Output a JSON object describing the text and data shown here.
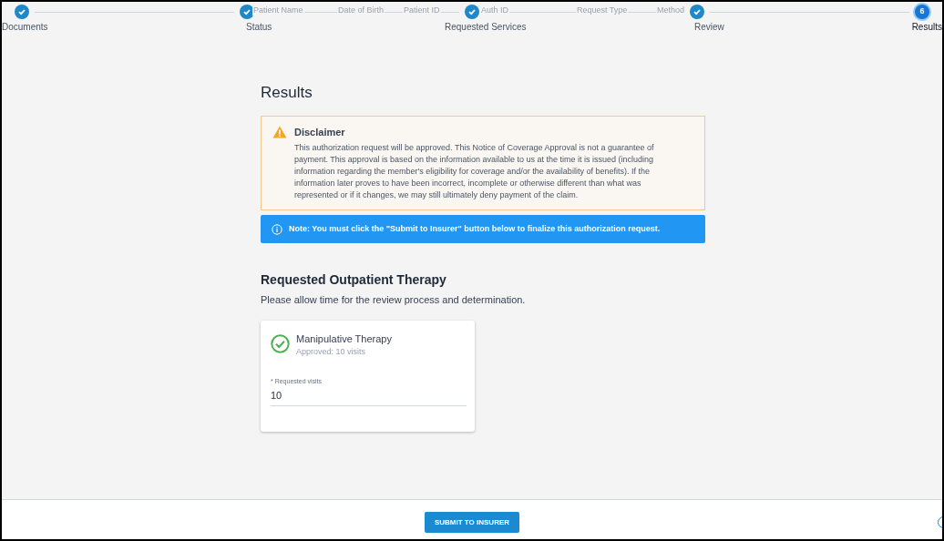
{
  "stepper": {
    "steps": [
      {
        "label": "Documents",
        "done": true,
        "selected": false
      },
      {
        "label": "Status",
        "done": true,
        "selected": false
      },
      {
        "label": "Requested Services",
        "done": true,
        "selected": false
      },
      {
        "label": "Review",
        "done": true,
        "selected": false
      },
      {
        "label": "Results",
        "done": false,
        "selected": true,
        "number": "6"
      }
    ]
  },
  "faded_header": [
    "Patient Name",
    "Date of Birth",
    "Patient ID",
    "Auth ID",
    "Request Type",
    "Method"
  ],
  "title": "Results",
  "disclaimer": {
    "title": "Disclaimer",
    "text": "This authorization request will be approved. This Notice of Coverage Approval is not a guarantee of payment. This approval is based on the information available to us at the time it is issued (including information regarding the member's eligibility for coverage and/or the availability of benefits). If the information later proves to have been incorrect, incomplete or otherwise different than what was represented or if it changes, we may still ultimately deny payment of the claim."
  },
  "note": "Note: You must click the \"Submit to Insurer\" button below to finalize this authorization request.",
  "section": {
    "title": "Requested Outpatient Therapy",
    "subtitle": "Please allow time for the review process and determination.",
    "services": [
      {
        "name": "Manipulative Therapy",
        "status": "Approved: 10 visits",
        "approved": true,
        "field_label": "* Requested visits",
        "value": "10"
      }
    ]
  },
  "footer": {
    "button": "SUBMIT TO INSURER"
  }
}
